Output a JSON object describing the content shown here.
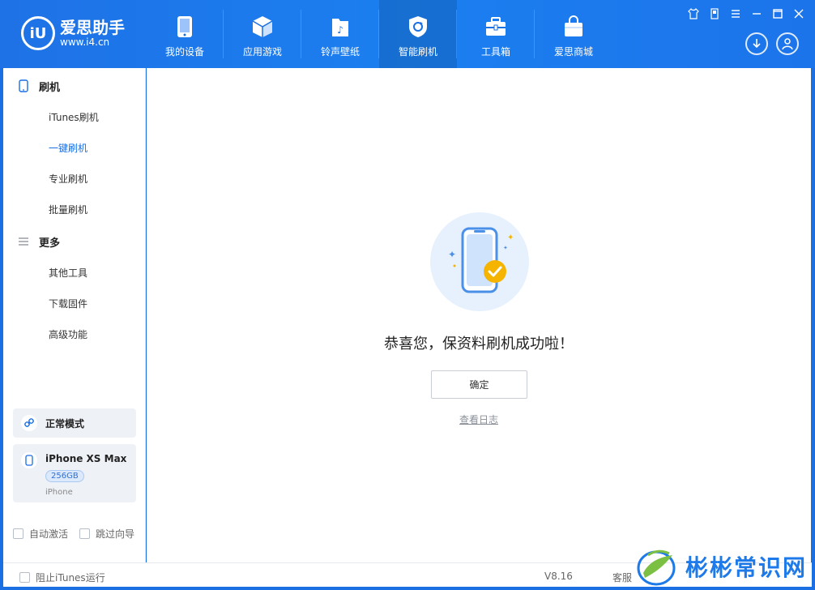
{
  "app": {
    "logo_mark": "iU",
    "name": "爱思助手",
    "url": "www.i4.cn"
  },
  "nav": [
    {
      "label": "我的设备",
      "icon": "phone-icon"
    },
    {
      "label": "应用游戏",
      "icon": "cube-icon"
    },
    {
      "label": "铃声壁纸",
      "icon": "music-file-icon"
    },
    {
      "label": "智能刷机",
      "icon": "refresh-shield-icon",
      "active": true
    },
    {
      "label": "工具箱",
      "icon": "toolbox-icon"
    },
    {
      "label": "爱思商城",
      "icon": "shopping-bag-icon"
    }
  ],
  "sidebar": {
    "sections": [
      {
        "title": "刷机",
        "icon": "phone-outline-icon",
        "items": [
          {
            "label": "iTunes刷机"
          },
          {
            "label": "一键刷机",
            "active": true
          },
          {
            "label": "专业刷机"
          },
          {
            "label": "批量刷机"
          }
        ]
      },
      {
        "title": "更多",
        "icon": "menu-lines-icon",
        "items": [
          {
            "label": "其他工具"
          },
          {
            "label": "下载固件"
          },
          {
            "label": "高级功能"
          }
        ]
      }
    ],
    "mode": "正常模式",
    "device": {
      "name": "iPhone XS Max",
      "capacity": "256GB",
      "type": "iPhone"
    },
    "auto_activate": "自动激活",
    "skip_guide": "跳过向导"
  },
  "main": {
    "success_message": "恭喜您，保资料刷机成功啦！",
    "confirm_button": "确定",
    "view_log": "查看日志"
  },
  "statusbar": {
    "block_itunes": "阻止iTunes运行",
    "version": "V8.16",
    "service": "客服"
  },
  "watermark": {
    "text": "彬彬常识网"
  },
  "colors": {
    "brand_blue": "#1a6fe3",
    "accent_yellow": "#f5b400",
    "link_gray": "#8a8f98"
  }
}
